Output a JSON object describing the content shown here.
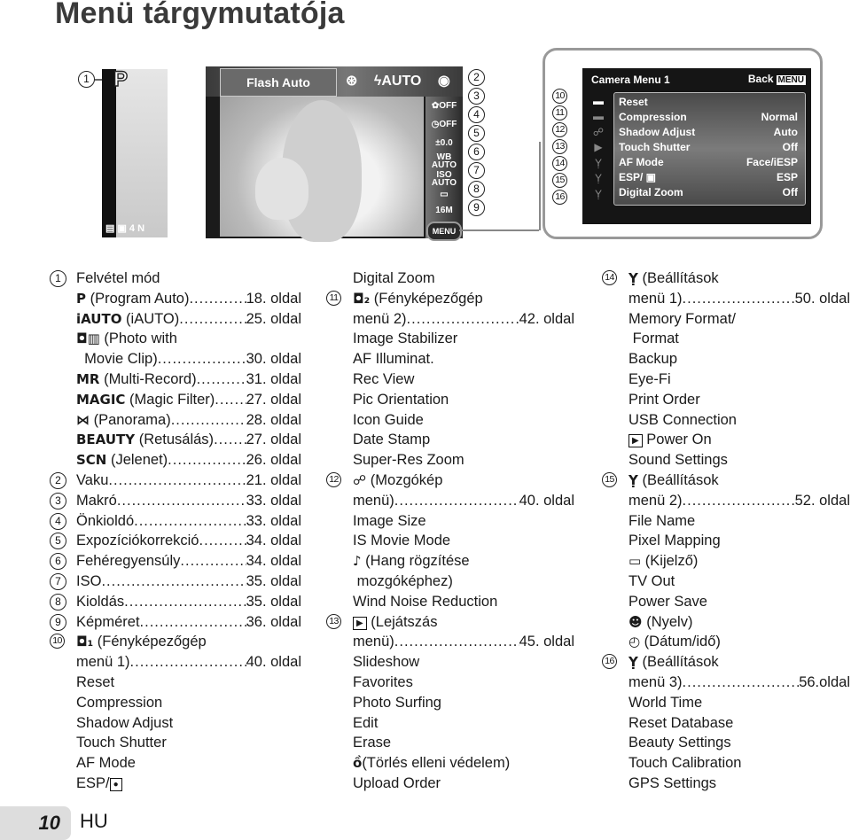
{
  "title": "Menü tárgymutatója",
  "diagram": {
    "screen1": {
      "mode_icon": "P",
      "status_bar": "▤ ▣ 4 N",
      "callout": "1"
    },
    "screen2": {
      "flash_label": "Flash Auto",
      "flash_options": [
        "⊛",
        "ϟAUTO",
        "◉",
        "ϟ"
      ],
      "side_icons": [
        "✿OFF",
        "◷OFF",
        "±0.0",
        "WB AUTO",
        "ISO AUTO",
        "▭",
        "16M"
      ],
      "menu_button": "MENU",
      "callouts": [
        "2",
        "3",
        "4",
        "5",
        "6",
        "7",
        "8",
        "9"
      ]
    },
    "camera_menu": {
      "header": "Camera Menu 1",
      "back_label": "Back",
      "back_key": "MENU",
      "tab_icons": [
        "camera-1-icon",
        "camera-2-icon",
        "movie-icon",
        "playback-icon",
        "settings-1-icon",
        "settings-2-icon",
        "settings-3-icon"
      ],
      "tab_glyphs": [
        "▬",
        "▬",
        "☍",
        "▶",
        "Ỵ",
        "Ỵ",
        "Ỵ"
      ],
      "items": [
        {
          "label": "Reset",
          "value": ""
        },
        {
          "label": "Compression",
          "value": "Normal"
        },
        {
          "label": "Shadow Adjust",
          "value": "Auto"
        },
        {
          "label": "Touch Shutter",
          "value": "Off"
        },
        {
          "label": "AF Mode",
          "value": "Face/iESP"
        },
        {
          "label": "ESP/ ▣",
          "value": "ESP"
        },
        {
          "label": "Digital Zoom",
          "value": "Off"
        }
      ],
      "callouts": [
        "10",
        "11",
        "12",
        "13",
        "14",
        "15",
        "16"
      ]
    }
  },
  "columns": {
    "col1": [
      {
        "num": "1",
        "text": "Felvétel mód"
      },
      {
        "sym": "P",
        "text": " (Program Auto)",
        "page": "18. oldal"
      },
      {
        "sym": "iAUTO",
        "text": " (iAUTO)",
        "page": "25. oldal"
      },
      {
        "sym": "◘▥",
        "text": " (Photo with"
      },
      {
        "text": "  Movie Clip)",
        "page": "30. oldal"
      },
      {
        "sym": "MR",
        "text": " (Multi-Record)",
        "page": "31. oldal"
      },
      {
        "sym": "MAGIC",
        "text": " (Magic Filter)",
        "page": "27. oldal"
      },
      {
        "sym": "⋈",
        "text": " (Panorama)",
        "page": "28. oldal"
      },
      {
        "sym": "BEAUTY",
        "text": " (Retusálás)",
        "page": "27. oldal"
      },
      {
        "sym": "SCN",
        "text": " (Jelenet)",
        "page": "26. oldal"
      },
      {
        "num": "2",
        "text": "Vaku",
        "page": "21. oldal"
      },
      {
        "num": "3",
        "text": "Makró",
        "page": "33. oldal"
      },
      {
        "num": "4",
        "text": "Önkioldó",
        "page": "33. oldal"
      },
      {
        "num": "5",
        "text": "Expozíciókorrekció",
        "page": "34. oldal"
      },
      {
        "num": "6",
        "text": "Fehéregyensúly",
        "page": "34. oldal"
      },
      {
        "num": "7",
        "text": "ISO",
        "page": "35. oldal"
      },
      {
        "num": "8",
        "text": "Kioldás",
        "page": "35. oldal"
      },
      {
        "num": "9",
        "text": "Képméret",
        "page": "36. oldal"
      },
      {
        "num": "10",
        "sym": "◘₁",
        "text": " (Fényképezőgép"
      },
      {
        "text": "menü 1)",
        "page": "40. oldal"
      },
      {
        "text": "Reset"
      },
      {
        "text": "Compression"
      },
      {
        "text": "Shadow Adjust"
      },
      {
        "text": "Touch Shutter"
      },
      {
        "text": "AF Mode"
      },
      {
        "text": "ESP/",
        "box": "●"
      }
    ],
    "col2": [
      {
        "text": "Digital Zoom"
      },
      {
        "num": "11",
        "sym": "◘₂",
        "text": " (Fényképezőgép"
      },
      {
        "text": "menü 2)",
        "page": "42. oldal"
      },
      {
        "text": "Image Stabilizer"
      },
      {
        "text": "AF Illuminat."
      },
      {
        "text": "Rec View"
      },
      {
        "text": "Pic Orientation"
      },
      {
        "text": "Icon Guide"
      },
      {
        "text": "Date Stamp"
      },
      {
        "text": "Super-Res Zoom"
      },
      {
        "num": "12",
        "sym": "☍",
        "text": " (Mozgókép"
      },
      {
        "text": "menü)",
        "page": "40. oldal"
      },
      {
        "text": "Image Size"
      },
      {
        "text": "IS Movie Mode"
      },
      {
        "sym": "♪",
        "text": " (Hang rögzítése"
      },
      {
        "text": " mozgóképhez)"
      },
      {
        "text": "Wind Noise Reduction"
      },
      {
        "num": "13",
        "box": "▶",
        "text": " (Lejátszás"
      },
      {
        "text": "menü)",
        "page": "45. oldal"
      },
      {
        "text": "Slideshow"
      },
      {
        "text": "Favorites"
      },
      {
        "text": "Photo Surfing"
      },
      {
        "text": "Edit"
      },
      {
        "text": "Erase"
      },
      {
        "sym": "ồ",
        "text": "(Törlés elleni védelem)"
      },
      {
        "text": "Upload Order"
      }
    ],
    "col3": [
      {
        "num": "14",
        "sym": "Ỵ",
        "text": " (Beállítások"
      },
      {
        "text": "menü 1)",
        "page": "50. oldal"
      },
      {
        "text": "Memory Format/"
      },
      {
        "text": " Format"
      },
      {
        "text": "Backup"
      },
      {
        "text": "Eye-Fi"
      },
      {
        "text": "Print Order"
      },
      {
        "text": "USB Connection"
      },
      {
        "box": "▶",
        "text": " Power On"
      },
      {
        "text": "Sound Settings"
      },
      {
        "num": "15",
        "sym": "Ỵ",
        "text": " (Beállítások"
      },
      {
        "text": "menü 2)",
        "page": "52. oldal"
      },
      {
        "text": "File Name"
      },
      {
        "text": "Pixel Mapping"
      },
      {
        "sym": "▭",
        "text": " (Kijelző)"
      },
      {
        "text": "TV Out"
      },
      {
        "text": "Power Save"
      },
      {
        "sym": "☻",
        "text": " (Nyelv)"
      },
      {
        "sym": "◴",
        "text": " (Dátum/idő)"
      },
      {
        "num": "16",
        "sym": "Ỵ",
        "text": " (Beállítások"
      },
      {
        "text": "menü 3)",
        "page": "56.oldal"
      },
      {
        "text": "World Time"
      },
      {
        "text": "Reset Database"
      },
      {
        "text": "Beauty Settings"
      },
      {
        "text": "Touch Calibration"
      },
      {
        "text": "GPS Settings"
      }
    ]
  },
  "footer": {
    "page_number": "10",
    "language": "HU"
  }
}
